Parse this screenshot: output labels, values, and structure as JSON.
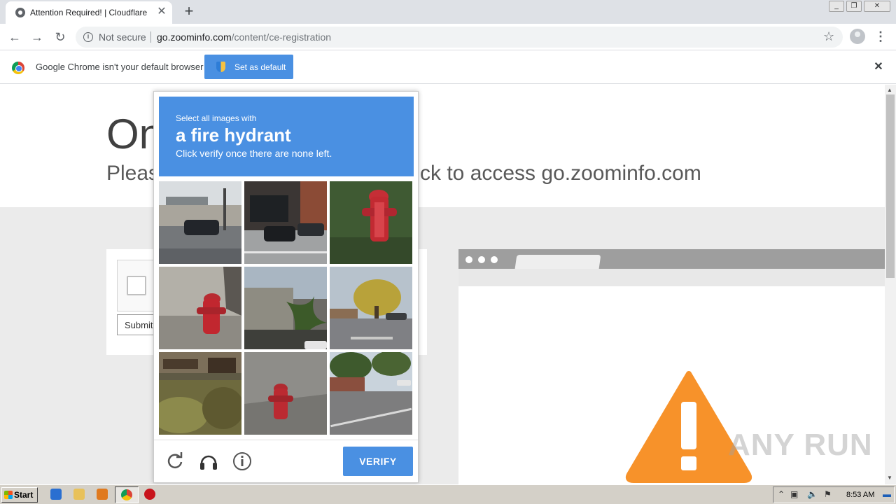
{
  "browser": {
    "tab_title": "Attention Required! | Cloudflare",
    "new_tab_glyph": "+",
    "security_label": "Not secure",
    "url_domain": "go.zoominfo.com",
    "url_path": "/content/ce-registration",
    "infobar_message": "Google Chrome isn't your default browser",
    "infobar_button": "Set as default"
  },
  "page": {
    "heading": "On",
    "subtitle": "Pleas",
    "subtitle_right": "ck to access go.zoominfo.com",
    "submit_label": "Submit",
    "watermark": "ANY RUN"
  },
  "recaptcha": {
    "instruction_line1": "Select all images with",
    "instruction_target": "a fire hydrant",
    "instruction_line3": "Click verify once there are none left.",
    "verify_label": "VERIFY",
    "tiles": [
      "street-intersection-car",
      "storefront-parked-cars",
      "fire-hydrant-grass",
      "fire-hydrant-gravel",
      "palm-trees-building",
      "parking-lot-tree",
      "wooded-hillside",
      "fire-hydrant-sidewalk",
      "street-with-trees"
    ],
    "icons": [
      "reload-icon",
      "audio-icon",
      "info-icon"
    ]
  },
  "taskbar": {
    "start_label": "Start",
    "clock": "8:53 AM"
  },
  "colors": {
    "recaptcha_blue": "#4a90e2",
    "warning_orange": "#f7922a"
  }
}
